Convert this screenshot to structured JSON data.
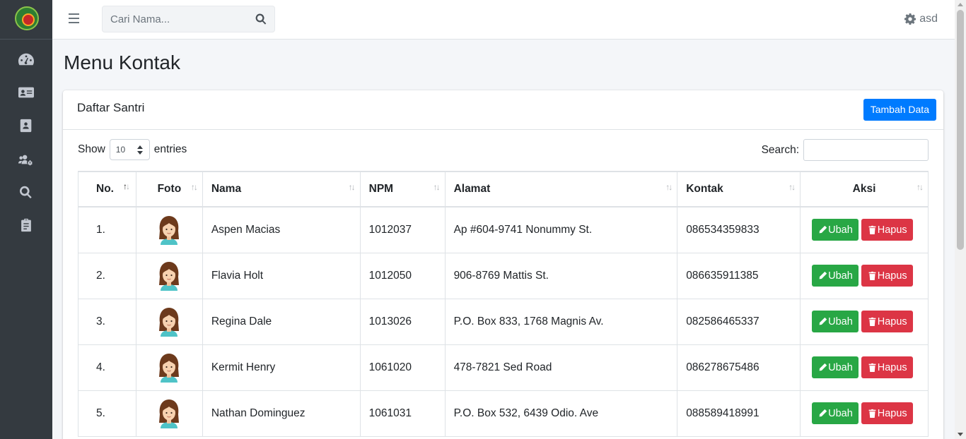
{
  "sidebar": {
    "logo": "app-logo",
    "items": [
      {
        "icon": "dashboard-icon"
      },
      {
        "icon": "id-card-icon"
      },
      {
        "icon": "contact-book-icon"
      },
      {
        "icon": "users-cog-icon"
      },
      {
        "icon": "search-icon"
      },
      {
        "icon": "clipboard-icon"
      }
    ]
  },
  "topbar": {
    "search_placeholder": "Cari Nama...",
    "user_name": "asd"
  },
  "page": {
    "title": "Menu Kontak"
  },
  "card": {
    "title": "Daftar Santri",
    "add_button": "Tambah Data"
  },
  "table_controls": {
    "show_label": "Show",
    "entries_value": "10",
    "entries_label": "entries",
    "search_label": "Search:"
  },
  "table": {
    "columns": [
      "No.",
      "Foto",
      "Nama",
      "NPM",
      "Alamat",
      "Kontak",
      "Aksi"
    ],
    "rows": [
      {
        "no": "1.",
        "nama": "Aspen Macias",
        "npm": "1012037",
        "alamat": "Ap #604-9741 Nonummy St.",
        "kontak": "086534359833"
      },
      {
        "no": "2.",
        "nama": "Flavia Holt",
        "npm": "1012050",
        "alamat": "906-8769 Mattis St.",
        "kontak": "086635911385"
      },
      {
        "no": "3.",
        "nama": "Regina Dale",
        "npm": "1013026",
        "alamat": "P.O. Box 833, 1768 Magnis Av.",
        "kontak": "082586465337"
      },
      {
        "no": "4.",
        "nama": "Kermit Henry",
        "npm": "1061020",
        "alamat": "478-7821 Sed Road",
        "kontak": "086278675486"
      },
      {
        "no": "5.",
        "nama": "Nathan Dominguez",
        "npm": "1061031",
        "alamat": "P.O. Box 532, 6439 Odio. Ave",
        "kontak": "088589418991"
      }
    ],
    "edit_label": "Ubah",
    "delete_label": "Hapus"
  },
  "colors": {
    "sidebar": "#343a40",
    "primary": "#007bff",
    "success": "#28a745",
    "danger": "#dc3545"
  }
}
